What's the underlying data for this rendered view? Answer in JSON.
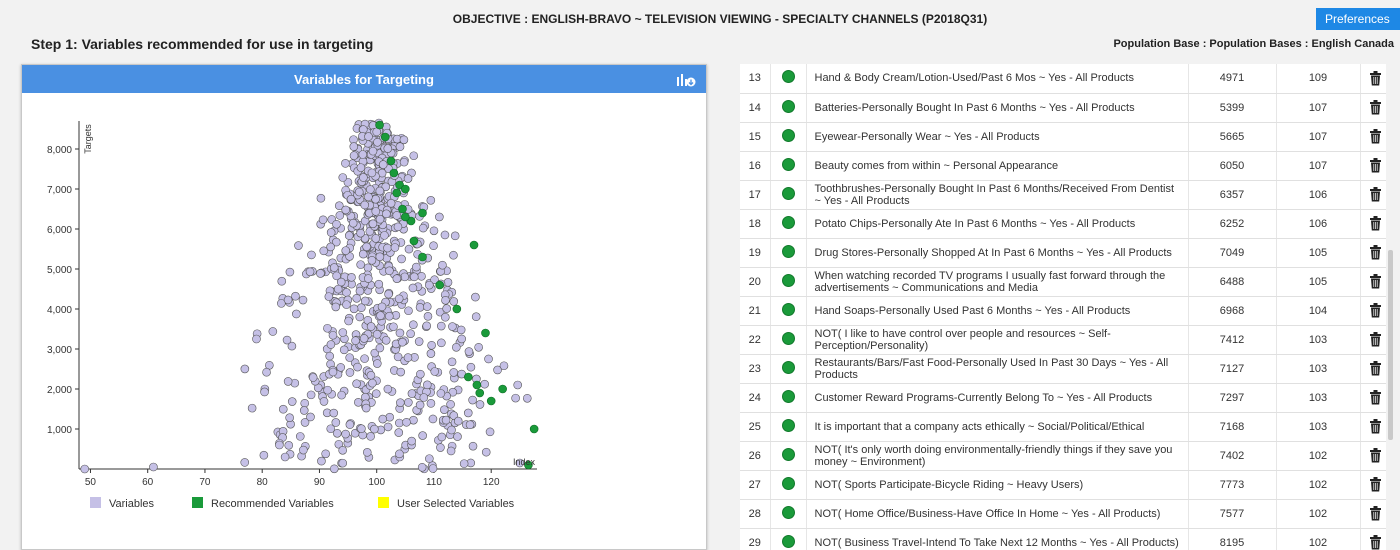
{
  "header": {
    "objective": "OBJECTIVE : ENGLISH-BRAVO ~ TELEVISION VIEWING - SPECIALTY CHANNELS (P2018Q31)",
    "preferences_label": "Preferences",
    "step_title": "Step 1: Variables recommended for use in targeting",
    "population_base": "Population Base : Population Bases : English Canada"
  },
  "panel": {
    "title": "Variables for Targeting",
    "export_icon": "export-chart-icon"
  },
  "colors": {
    "header_blue": "#4a90e2",
    "button_blue": "#1e88e5",
    "variables": "#c5c0e6",
    "recommended": "#1a9a3a",
    "user_selected": "#ffff00"
  },
  "chart_data": {
    "type": "scatter",
    "xlabel": "Index",
    "ylabel": "Targets",
    "xlim": [
      48,
      128
    ],
    "ylim": [
      0,
      8700
    ],
    "x_ticks": [
      50,
      60,
      70,
      80,
      90,
      100,
      110,
      120
    ],
    "y_ticks": [
      1000,
      2000,
      3000,
      4000,
      5000,
      6000,
      7000,
      8000
    ],
    "y_tick_labels": [
      "1,000",
      "2,000",
      "3,000",
      "4,000",
      "5,000",
      "6,000",
      "7,000",
      "8,000"
    ],
    "legend": [
      "Variables",
      "Recommended Variables",
      "User Selected Variables"
    ],
    "recommended_points": [
      [
        100.5,
        8600
      ],
      [
        101.5,
        8300
      ],
      [
        102.5,
        7700
      ],
      [
        103,
        7400
      ],
      [
        104,
        7100
      ],
      [
        105,
        7000
      ],
      [
        104.5,
        6500
      ],
      [
        106,
        6200
      ],
      [
        106.5,
        5700
      ],
      [
        108,
        5300
      ],
      [
        111,
        4600
      ],
      [
        114,
        4000
      ],
      [
        117,
        5600
      ],
      [
        119,
        3400
      ],
      [
        116,
        2300
      ],
      [
        117.5,
        2100
      ],
      [
        118,
        1900
      ],
      [
        120,
        1700
      ],
      [
        122,
        2000
      ],
      [
        127.5,
        1000
      ],
      [
        126.5,
        100
      ],
      [
        108,
        6400
      ],
      [
        103.5,
        6900
      ],
      [
        105,
        6300
      ]
    ],
    "variables_summary": "dense cluster of approx. 700 variables centred near index 100",
    "variables_outliers": [
      [
        49,
        0
      ],
      [
        61,
        50
      ],
      [
        79,
        3250
      ],
      [
        83,
        600
      ],
      [
        84,
        300
      ],
      [
        125,
        150
      ]
    ]
  },
  "table": {
    "rows": [
      {
        "num": "13",
        "desc": "Hand & Body Cream/Lotion-Used/Past 6 Mos ~ Yes - All Products",
        "targets": "4971",
        "index": "109"
      },
      {
        "num": "14",
        "desc": "Batteries-Personally Bought In Past 6 Months ~ Yes - All Products",
        "targets": "5399",
        "index": "107"
      },
      {
        "num": "15",
        "desc": "Eyewear-Personally Wear ~ Yes - All Products",
        "targets": "5665",
        "index": "107"
      },
      {
        "num": "16",
        "desc": "Beauty comes from within ~ Personal Appearance",
        "targets": "6050",
        "index": "107"
      },
      {
        "num": "17",
        "desc": "Toothbrushes-Personally Bought In Past 6 Months/Received From Dentist ~ Yes - All Products",
        "targets": "6357",
        "index": "106"
      },
      {
        "num": "18",
        "desc": "Potato Chips-Personally Ate In Past 6 Months ~ Yes - All Products",
        "targets": "6252",
        "index": "106"
      },
      {
        "num": "19",
        "desc": "Drug Stores-Personally Shopped At In Past 6 Months ~ Yes - All Products",
        "targets": "7049",
        "index": "105"
      },
      {
        "num": "20",
        "desc": "When watching recorded TV programs I usually fast forward through the advertisements ~ Communications and Media",
        "targets": "6488",
        "index": "105"
      },
      {
        "num": "21",
        "desc": "Hand Soaps-Personally Used Past 6 Months ~ Yes - All Products",
        "targets": "6968",
        "index": "104"
      },
      {
        "num": "22",
        "desc": "NOT( I like to have control over people and resources ~ Self-Perception/Personality)",
        "targets": "7412",
        "index": "103"
      },
      {
        "num": "23",
        "desc": "Restaurants/Bars/Fast Food-Personally Used In Past 30 Days ~ Yes - All Products",
        "targets": "7127",
        "index": "103"
      },
      {
        "num": "24",
        "desc": "Customer Reward Programs-Currently Belong To ~ Yes - All Products",
        "targets": "7297",
        "index": "103"
      },
      {
        "num": "25",
        "desc": "It is important that a company acts ethically ~ Social/Political/Ethical",
        "targets": "7168",
        "index": "103"
      },
      {
        "num": "26",
        "desc": "NOT( It's only worth doing environmentally-friendly things if they save you money ~ Environment)",
        "targets": "7402",
        "index": "102"
      },
      {
        "num": "27",
        "desc": "NOT( Sports Participate-Bicycle Riding ~ Heavy Users)",
        "targets": "7773",
        "index": "102"
      },
      {
        "num": "28",
        "desc": "NOT( Home Office/Business-Have Office In Home ~ Yes - All Products)",
        "targets": "7577",
        "index": "102"
      },
      {
        "num": "29",
        "desc": "NOT( Business Travel-Intend To Take Next 12 Months ~ Yes - All Products)",
        "targets": "8195",
        "index": "102"
      }
    ]
  }
}
